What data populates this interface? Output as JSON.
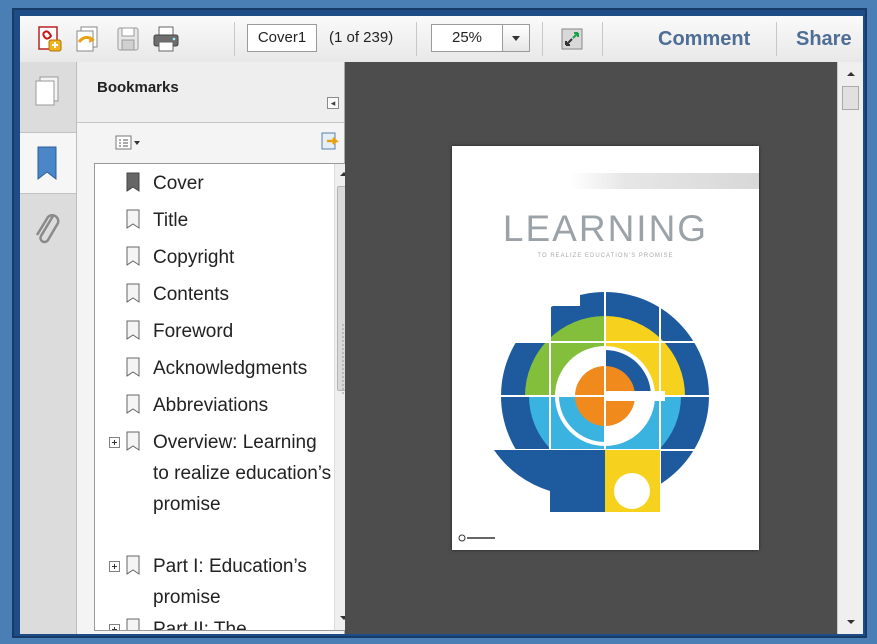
{
  "toolbar": {
    "page_field": "Cover1",
    "page_count": "(1 of 239)",
    "zoom": "25%",
    "comment": "Comment",
    "share": "Share",
    "icons": [
      "create-pdf-icon",
      "combine-files-icon",
      "save-icon",
      "print-icon",
      "fit-page-icon"
    ]
  },
  "bookmarks": {
    "title": "Bookmarks",
    "items": [
      {
        "label": "Cover",
        "expandable": false
      },
      {
        "label": "Title",
        "expandable": false
      },
      {
        "label": "Copyright",
        "expandable": false
      },
      {
        "label": "Contents",
        "expandable": false
      },
      {
        "label": "Foreword",
        "expandable": false
      },
      {
        "label": "Acknowledgments",
        "expandable": false
      },
      {
        "label": "Abbreviations",
        "expandable": false
      },
      {
        "label": "Overview: Learning to realize education’s promise",
        "expandable": true
      },
      {
        "label": "Part I: Education’s promise",
        "expandable": true
      },
      {
        "label": "Part II: The",
        "expandable": true
      }
    ]
  },
  "cover": {
    "title": "LEARNING",
    "subtitle": "TO REALIZE EDUCATION’S PROMISE",
    "colors": {
      "navy": "#1d5a9e",
      "sky": "#3bb3e0",
      "yellow": "#f6d11d",
      "orange": "#f08a1d",
      "green": "#84bf3c"
    }
  },
  "colors": {
    "accent_link": "#4f6e96",
    "doc_background": "#4d4d4d",
    "frame": "#1e4c86"
  }
}
